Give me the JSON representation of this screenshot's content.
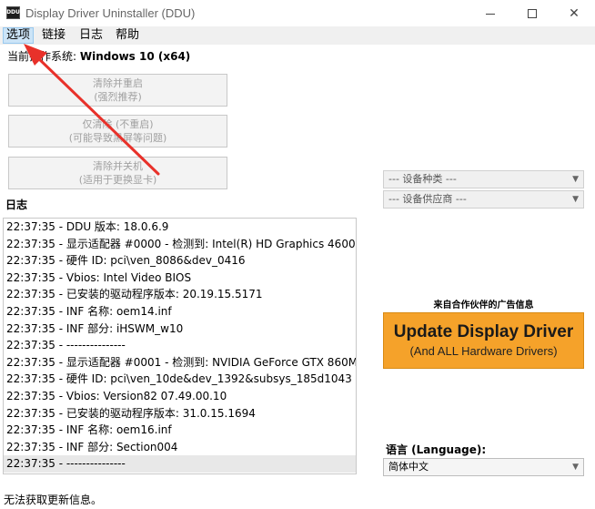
{
  "window": {
    "icon_text": "DDU",
    "title": "Display Driver Uninstaller (DDU)"
  },
  "menu": {
    "items": [
      "选项",
      "链接",
      "日志",
      "帮助"
    ]
  },
  "os": {
    "label": "当前操作系统: ",
    "value": "Windows 10 (x64)"
  },
  "actions": [
    {
      "line1": "清除并重启",
      "line2": "(强烈推荐)"
    },
    {
      "line1": "仅清除 (不重启)",
      "line2": "(可能导致黑屏等问题)"
    },
    {
      "line1": "清除并关机",
      "line2": "(适用于更换显卡)"
    }
  ],
  "device_type": {
    "selected": "--- 设备种类 ---"
  },
  "device_vendor": {
    "selected": "--- 设备供应商 ---"
  },
  "log": {
    "title": "日志",
    "lines": [
      "22:37:35 - DDU 版本: 18.0.6.9",
      "22:37:35 - 显示适配器 #0000 - 检测到: Intel(R) HD Graphics 4600",
      "22:37:35 - 硬件 ID: pci\\ven_8086&dev_0416",
      "22:37:35 - Vbios: Intel Video BIOS",
      "22:37:35 - 已安装的驱动程序版本: 20.19.15.5171",
      "22:37:35 - INF 名称: oem14.inf",
      "22:37:35 - INF 部分: iHSWM_w10",
      "22:37:35 - ---------------",
      "22:37:35 - 显示适配器 #0001 - 检测到: NVIDIA GeForce GTX 860M",
      "22:37:35 - 硬件 ID: pci\\ven_10de&dev_1392&subsys_185d1043",
      "22:37:35 - Vbios: Version82 07.49.00.10",
      "22:37:35 - 已安装的驱动程序版本: 31.0.15.1694",
      "22:37:35 - INF 名称: oem16.inf",
      "22:37:35 - INF 部分: Section004",
      "22:37:35 - ---------------"
    ]
  },
  "ad": {
    "label": "来自合作伙伴的广告信息",
    "line1": "Update Display Driver",
    "line2": "(And ALL Hardware Drivers)"
  },
  "language": {
    "label": "语言 (Language):",
    "selected": "简体中文"
  },
  "status": "无法获取更新信息。",
  "colors": {
    "ad_background": "#f5a22a",
    "annotation_arrow": "#e8312a",
    "menu_highlight": "#cce4f7"
  }
}
